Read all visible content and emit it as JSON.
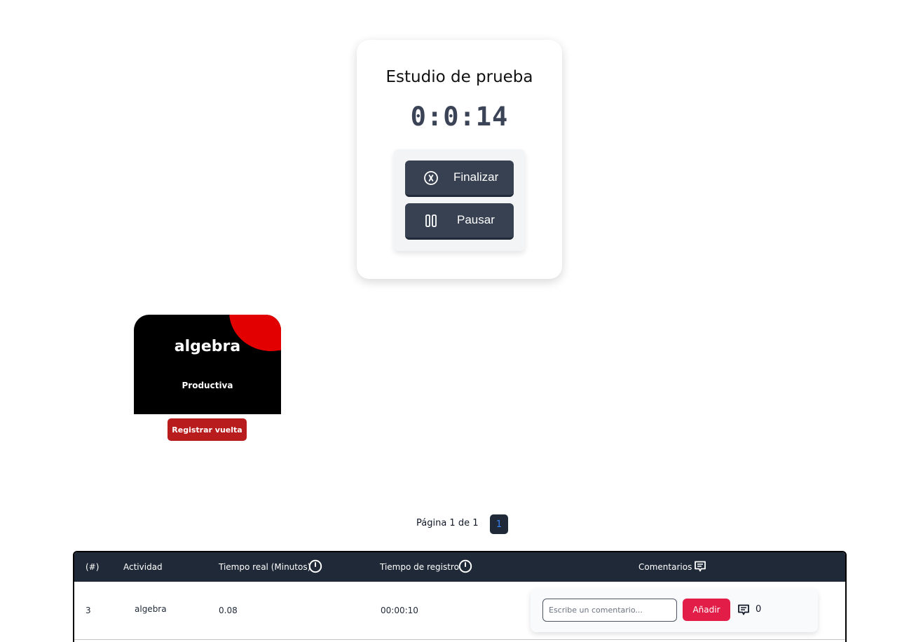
{
  "timer": {
    "title": "Estudio de prueba",
    "elapsed": "0:0:14",
    "finish_label": "Finalizar",
    "pause_label": "Pausar",
    "finish_icon": "x-circle-icon",
    "pause_icon": "pause-icon"
  },
  "activity": {
    "name": "algebra",
    "type": "Productiva",
    "lap_label": "Registrar vuelta",
    "colors": {
      "card": "#000000",
      "accent": "#e30000",
      "button": "#b91c1c"
    }
  },
  "pagination": {
    "text": "Página 1 de 1",
    "current": "1"
  },
  "table": {
    "headers": {
      "index": "(#)",
      "activity": "Actividad",
      "real_time": "Tiempo real (Minutos)",
      "record_time": "Tiempo de registro",
      "comments": "Comentarios"
    },
    "rows": [
      {
        "index": "3",
        "activity": "algebra",
        "real_time": "0.08",
        "record_time": "00:00:10",
        "comment_placeholder": "Escribe un comentario...",
        "add_label": "Añadir",
        "comment_count": "0"
      }
    ]
  }
}
